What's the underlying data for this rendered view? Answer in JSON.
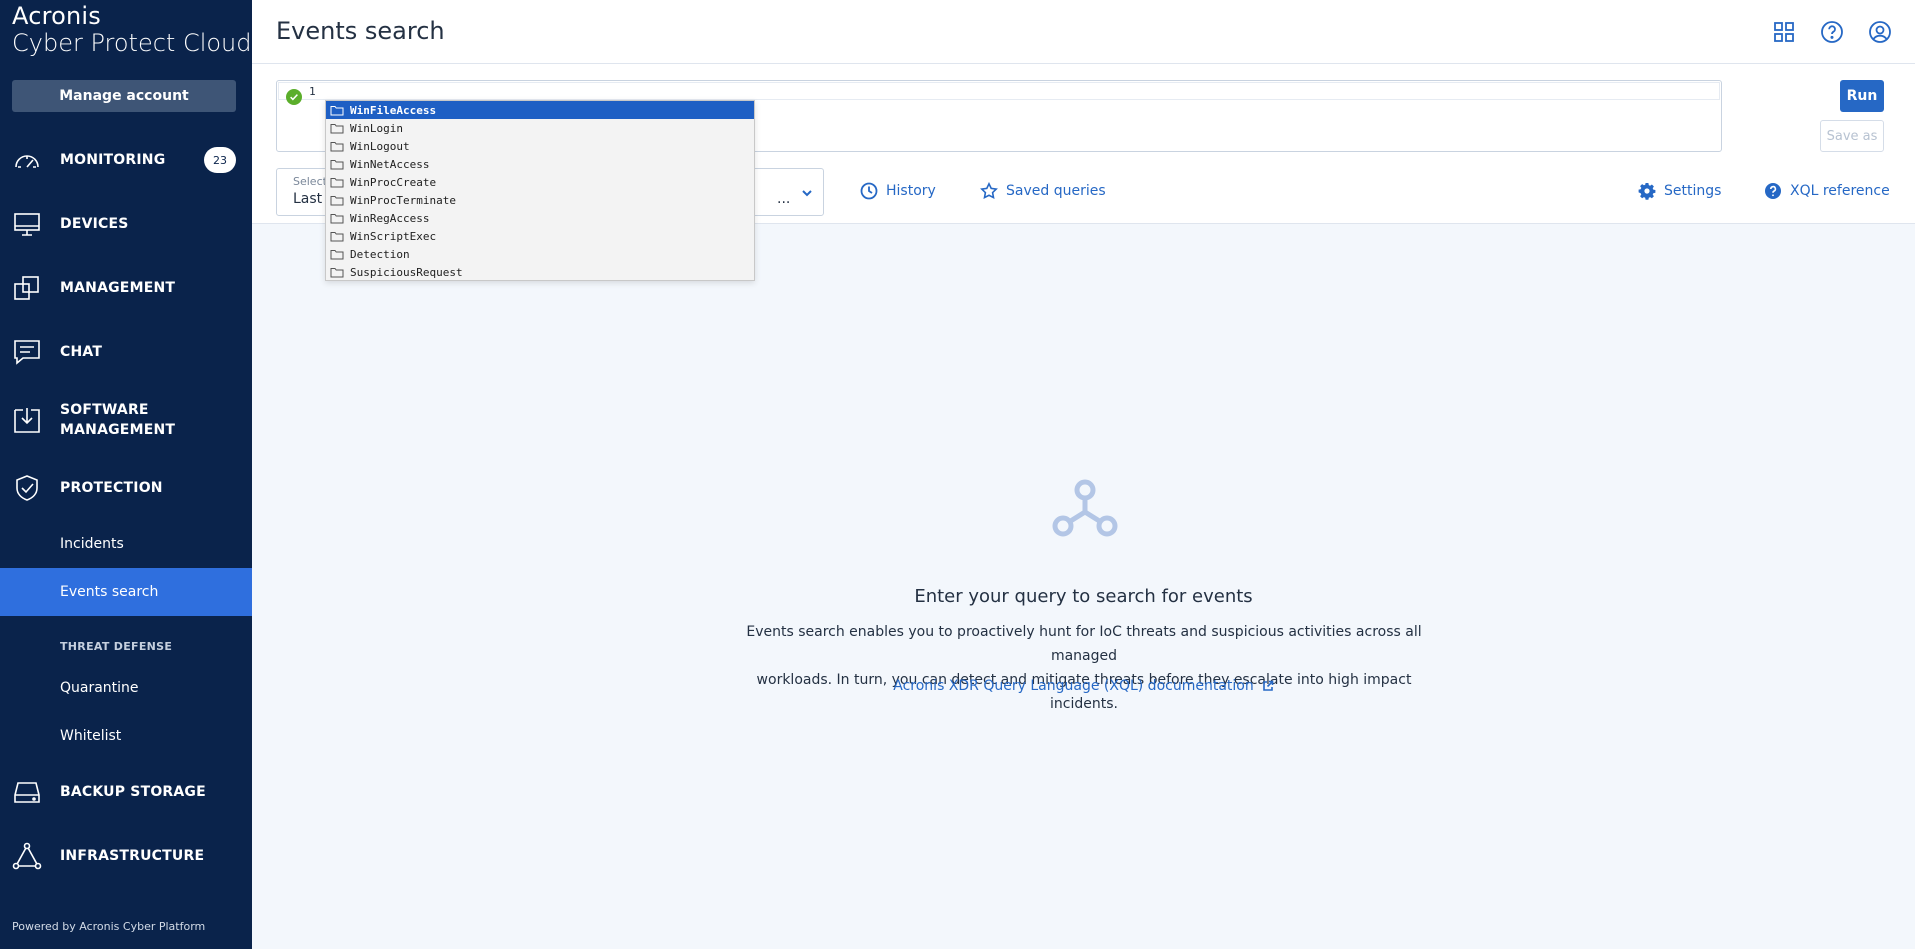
{
  "brand": {
    "line1": "Acronis",
    "line2": "Cyber Protect Cloud"
  },
  "sidebar": {
    "manage_account": "Manage account",
    "monitoring": {
      "label": "MONITORING",
      "badge": "23"
    },
    "devices": "DEVICES",
    "management": "MANAGEMENT",
    "chat": "CHAT",
    "software_management": {
      "line1": "SOFTWARE",
      "line2": "MANAGEMENT"
    },
    "protection": "PROTECTION",
    "incidents": "Incidents",
    "events_search": "Events search",
    "threat_defense": "THREAT DEFENSE",
    "quarantine": "Quarantine",
    "whitelist": "Whitelist",
    "backup_storage": "BACKUP STORAGE",
    "infrastructure": "INFRASTRUCTURE",
    "powered_by": "Powered by Acronis Cyber Platform"
  },
  "header": {
    "title": "Events search"
  },
  "query": {
    "line_number": "1",
    "run": "Run",
    "save_as": "Save as",
    "time_select_label": "Select",
    "time_select_value": "Last",
    "time_select_tail": "...",
    "history": "History",
    "saved_queries": "Saved queries",
    "settings": "Settings",
    "xql_reference": "XQL reference"
  },
  "autocomplete": {
    "items": [
      "WinFileAccess",
      "WinLogin",
      "WinLogout",
      "WinNetAccess",
      "WinProcCreate",
      "WinProcTerminate",
      "WinRegAccess",
      "WinScriptExec",
      "Detection",
      "SuspiciousRequest"
    ],
    "selected": "WinFileAccess"
  },
  "empty_state": {
    "title": "Enter your query to search for events",
    "desc_line1": "Events search enables you to proactively hunt for IoC threats and suspicious activities across all managed",
    "desc_line2": "workloads. In turn, you can detect and mitigate threats before they escalate into high impact incidents.",
    "doc_link": "Acronis XDR Query Language (XQL) documentation"
  },
  "colors": {
    "sidebar_bg": "#0a234b",
    "accent": "#2668c5",
    "active_item": "#2f6fde",
    "success": "#5bae2b"
  }
}
